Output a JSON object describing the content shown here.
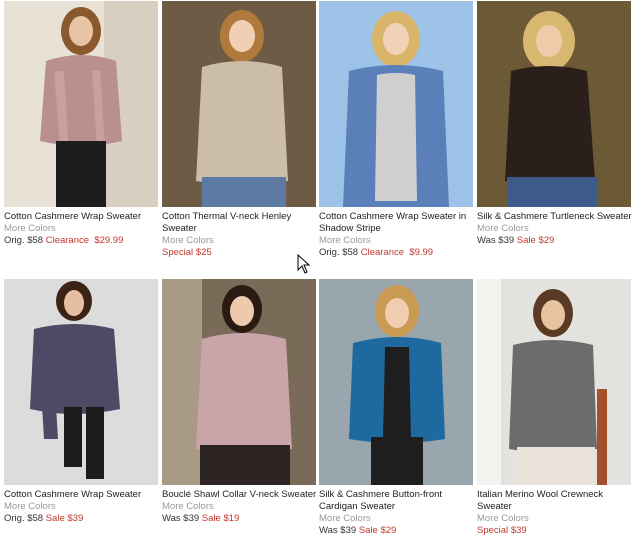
{
  "products": [
    {
      "name": "Cotton Cashmere Wrap Sweater",
      "more": "More Colors",
      "price_prefix": "Orig. $58",
      "sale_label": "Clearance",
      "sale_price": "$29.99",
      "colors": {
        "bg": "#e8e2d6",
        "top": "#b98f8f",
        "pants": "#1d1d1d",
        "hair": "#8a5a2e"
      }
    },
    {
      "name": "Cotton Thermal V-neck Henley Sweater",
      "more": "More Colors",
      "price_prefix": "",
      "sale_label": "Special",
      "sale_price": "$25",
      "colors": {
        "bg": "#6d5b45",
        "top": "#cbbda6",
        "pants": "#5d7aa3",
        "hair": "#b07a3c"
      }
    },
    {
      "name": "Cotton Cashmere Wrap Sweater in Shadow Stripe",
      "more": "More Colors",
      "price_prefix": "Orig. $58",
      "sale_label": "Clearance",
      "sale_price": "$9.99",
      "colors": {
        "bg": "#9ec3e8",
        "top": "#5b7fb8",
        "pants": "#cfcfcf",
        "hair": "#d9b56a"
      }
    },
    {
      "name": "Silk & Cashmere Turtleneck Sweater",
      "more": "More Colors",
      "price_prefix": "Was $39",
      "sale_label": "Sale",
      "sale_price": "$29",
      "colors": {
        "bg": "#6b5a35",
        "top": "#2a1f1a",
        "pants": "#3c5a8a",
        "hair": "#d8b870"
      }
    },
    {
      "name": "Cotton Cashmere Wrap Sweater",
      "more": "More Colors",
      "price_prefix": "Orig.  $58",
      "sale_label": "Sale",
      "sale_price": "$39",
      "colors": {
        "bg": "#dcdcdc",
        "top": "#4e4a66",
        "pants": "#1c1c1c",
        "hair": "#3b2416"
      }
    },
    {
      "name": "Bouclé Shawl Collar V-neck Sweater",
      "more": "More Colors",
      "price_prefix": "Was $39",
      "sale_label": "Sale",
      "sale_price": "$19",
      "colors": {
        "bg": "#7a6a58",
        "top": "#c9a4a8",
        "pants": "#2b2422",
        "hair": "#2b1a12"
      }
    },
    {
      "name": "Silk & Cashmere Button-front Cardigan Sweater",
      "more": "More Colors",
      "price_prefix": "Was $39",
      "sale_label": "Sale",
      "sale_price": "$29",
      "colors": {
        "bg": "#9aa6ad",
        "top": "#1e6aa0",
        "pants": "#1e1e1e",
        "hair": "#c99a52"
      }
    },
    {
      "name": "Italian Merino Wool Crewneck Sweater",
      "more": "More Colors",
      "price_prefix": "",
      "sale_label": "Special",
      "sale_price": "$39",
      "colors": {
        "bg": "#e4e2de",
        "top": "#6c6c6c",
        "pants": "#e9e3da",
        "hair": "#5a3a22"
      }
    }
  ],
  "cursor_icon": "arrow-cursor-icon"
}
